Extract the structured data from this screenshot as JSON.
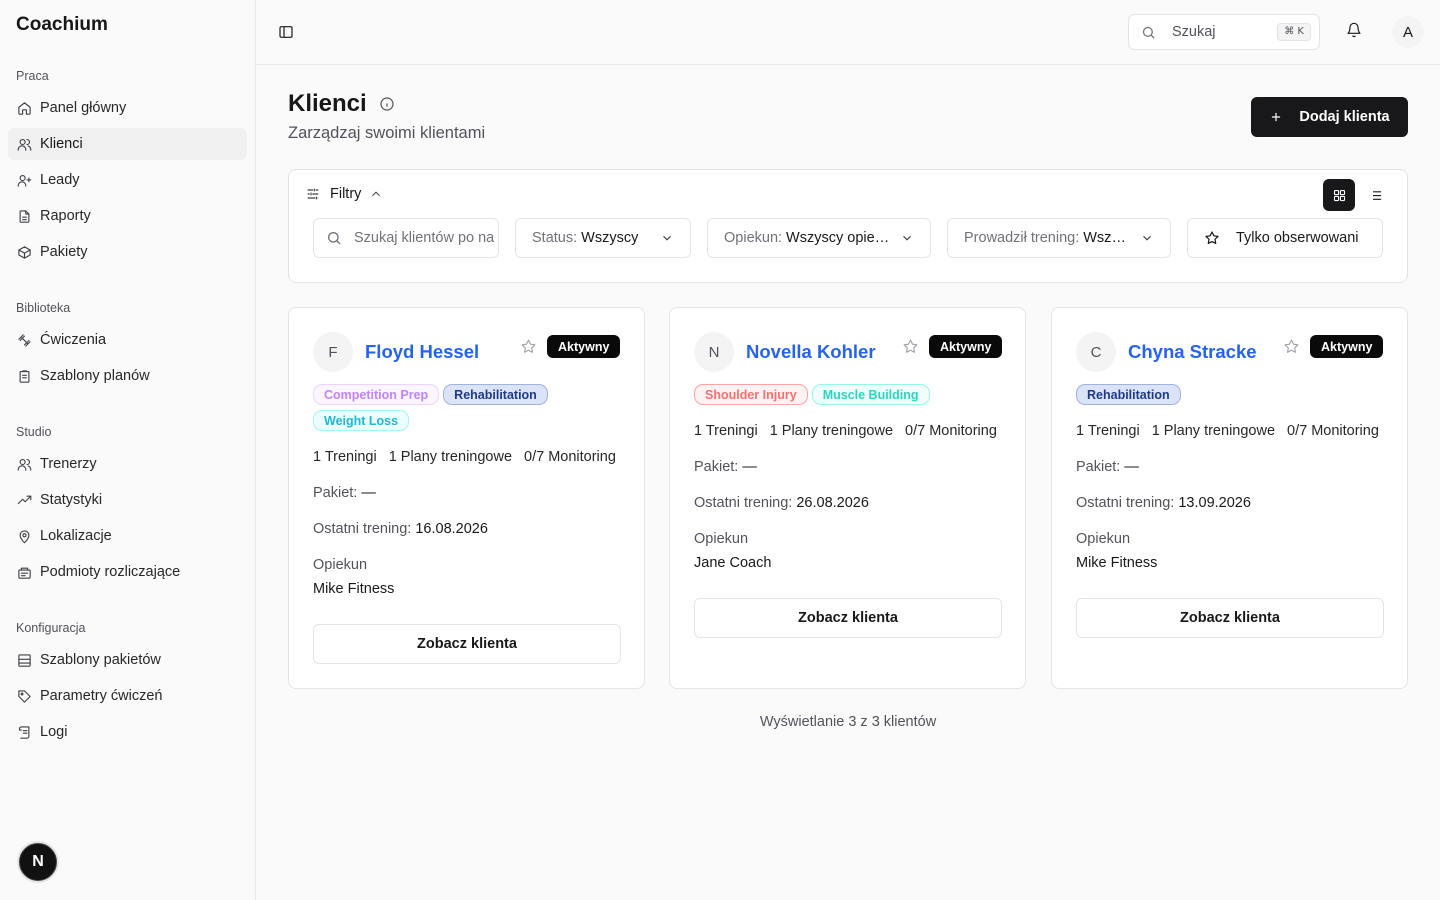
{
  "app": {
    "brand": "Coachium"
  },
  "sidebar": {
    "sections": [
      {
        "heading": "Praca",
        "items": [
          {
            "label": "Panel główny",
            "icon": "home-icon"
          },
          {
            "label": "Klienci",
            "icon": "users-icon",
            "active": true
          },
          {
            "label": "Leady",
            "icon": "user-plus-icon"
          },
          {
            "label": "Raporty",
            "icon": "file-icon"
          },
          {
            "label": "Pakiety",
            "icon": "package-icon"
          }
        ]
      },
      {
        "heading": "Biblioteka",
        "items": [
          {
            "label": "Ćwiczenia",
            "icon": "dumbbell-icon"
          },
          {
            "label": "Szablony planów",
            "icon": "clipboard-icon"
          }
        ]
      },
      {
        "heading": "Studio",
        "items": [
          {
            "label": "Trenerzy",
            "icon": "users-icon"
          },
          {
            "label": "Statystyki",
            "icon": "trending-up-icon"
          },
          {
            "label": "Lokalizacje",
            "icon": "map-pin-icon"
          },
          {
            "label": "Podmioty rozliczające",
            "icon": "receipt-icon"
          }
        ]
      },
      {
        "heading": "Konfiguracja",
        "items": [
          {
            "label": "Szablony pakietów",
            "icon": "layout-icon"
          },
          {
            "label": "Parametry ćwiczeń",
            "icon": "tag-icon"
          },
          {
            "label": "Logi",
            "icon": "scroll-icon"
          }
        ]
      }
    ],
    "devtools_badge": "N"
  },
  "topbar": {
    "search_label": "Szukaj",
    "search_shortcut": "⌘ K",
    "avatar_initial": "A"
  },
  "page": {
    "title": "Klienci",
    "subtitle": "Zarządzaj swoimi klientami",
    "add_button": "Dodaj klienta"
  },
  "filters": {
    "title": "Filtry",
    "search_placeholder": "Szukaj klientów po nazwie",
    "status": {
      "label": "Status:",
      "value": "Wszyscy"
    },
    "coach": {
      "label": "Opiekun:",
      "value": "Wszyscy opiekunowie"
    },
    "trainer": {
      "label": "Prowadził trening:",
      "value": "Wszyscy"
    },
    "watched_only": "Tylko obserwowani",
    "view_mode": "grid"
  },
  "colors": {
    "accent": "#18181b",
    "link": "#2563eb",
    "tag_purple": "#c084fc",
    "tag_indigo": "#1e3a8a",
    "tag_cyan": "#22b8cf",
    "tag_red": "#f87171",
    "tag_teal": "#2dd4bf"
  },
  "clients": [
    {
      "initial": "F",
      "name": "Floyd Hessel",
      "status": "Aktywny",
      "tags": [
        {
          "label": "Competition Prep",
          "style": "purple"
        },
        {
          "label": "Rehabilitation",
          "style": "indigo"
        },
        {
          "label": "Weight Loss",
          "style": "cyan"
        }
      ],
      "stats": [
        "1 Treningi",
        "1 Plany treningowe",
        "0/7 Monitoring"
      ],
      "package_label": "Pakiet:",
      "package_value": "—",
      "last_training_label": "Ostatni trening:",
      "last_training_value": "16.08.2026",
      "coach_label": "Opiekun",
      "coach_value": "Mike Fitness",
      "view_button": "Zobacz klienta"
    },
    {
      "initial": "N",
      "name": "Novella Kohler",
      "status": "Aktywny",
      "tags": [
        {
          "label": "Shoulder Injury",
          "style": "red"
        },
        {
          "label": "Muscle Building",
          "style": "teal"
        }
      ],
      "stats": [
        "1 Treningi",
        "1 Plany treningowe",
        "0/7 Monitoring"
      ],
      "package_label": "Pakiet:",
      "package_value": "—",
      "last_training_label": "Ostatni trening:",
      "last_training_value": "26.08.2026",
      "coach_label": "Opiekun",
      "coach_value": "Jane Coach",
      "view_button": "Zobacz klienta"
    },
    {
      "initial": "C",
      "name": "Chyna Stracke",
      "status": "Aktywny",
      "tags": [
        {
          "label": "Rehabilitation",
          "style": "indigo"
        }
      ],
      "stats": [
        "1 Treningi",
        "1 Plany treningowe",
        "0/7 Monitoring"
      ],
      "package_label": "Pakiet:",
      "package_value": "—",
      "last_training_label": "Ostatni trening:",
      "last_training_value": "13.09.2026",
      "coach_label": "Opiekun",
      "coach_value": "Mike Fitness",
      "view_button": "Zobacz klienta"
    }
  ],
  "footer": {
    "count_text": "Wyświetlanie 3 z 3 klientów"
  }
}
